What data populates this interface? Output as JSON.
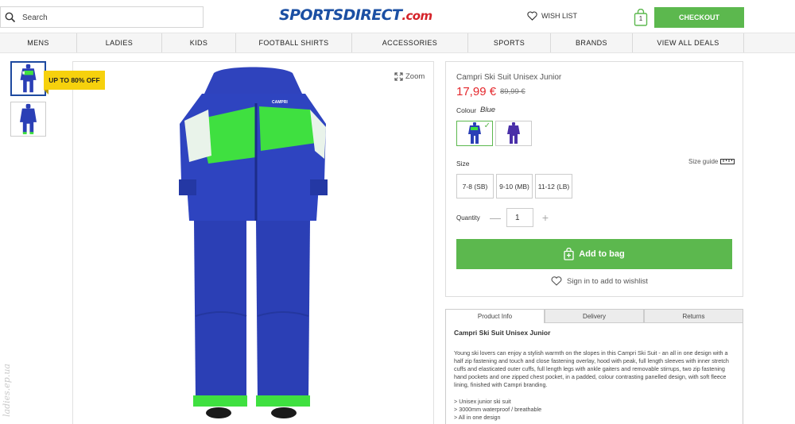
{
  "header": {
    "search_placeholder": "Search",
    "logo_main": "SPORTSDIRECT",
    "logo_domain": ".com",
    "wishlist_label": "WISH LIST",
    "bag_count": "1",
    "checkout_label": "CHECKOUT"
  },
  "nav": {
    "items": [
      {
        "label": "MENS"
      },
      {
        "label": "LADIES"
      },
      {
        "label": "KIDS"
      },
      {
        "label": "FOOTBALL SHIRTS"
      },
      {
        "label": "ACCESSORIES"
      },
      {
        "label": "SPORTS"
      },
      {
        "label": "BRANDS"
      },
      {
        "label": "VIEW ALL DEALS"
      }
    ]
  },
  "gallery": {
    "promo_badge": "UP TO 80% OFF",
    "zoom_label": "Zoom",
    "suit_brand_text": "CAMPRI"
  },
  "watermark": "ladies.ep.ua",
  "product": {
    "title": "Campri Ski Suit Unisex Junior",
    "price_now": "17,99 €",
    "price_was": "89,99 €",
    "colour_label": "Colour",
    "colour_value": "Blue",
    "size_label": "Size",
    "size_guide_label": "Size guide",
    "sizes": [
      {
        "label": "7-8 (SB)"
      },
      {
        "label": "9-10 (MB)"
      },
      {
        "label": "11-12 (LB)"
      }
    ],
    "quantity_label": "Quantity",
    "quantity_value": "1",
    "add_to_bag_label": "Add to bag",
    "wishlist_signin_label": "Sign in to add to wishlist"
  },
  "tabs": [
    {
      "label": "Product Info"
    },
    {
      "label": "Delivery"
    },
    {
      "label": "Returns"
    }
  ],
  "info": {
    "title": "Campri Ski Suit Unisex Junior",
    "description": "Young ski lovers can enjoy a stylish warmth on the slopes in this Campri Ski Suit - an all in one design with a half zip fastening and touch and close fastening overlay, hood with peak, full length sleeves with inner stretch cuffs and elasticated outer cuffs, full length legs with ankle gaiters and removable stirrups, two zip fastening hand pockets and one zipped chest pocket, in a padded, colour contrasting panelled design, with soft fleece lining, finished with Campri branding.",
    "bullets": [
      "> Unisex junior ski suit",
      "> 3000mm waterproof / breathable",
      "> All in one design"
    ]
  },
  "colors": {
    "accent_green": "#5cb84e",
    "price_red": "#e4272c",
    "brand_blue": "#1b4fa3",
    "promo_yellow": "#f6d10d",
    "suit_blue": "#2a3fb6",
    "suit_green": "#3fe040"
  }
}
